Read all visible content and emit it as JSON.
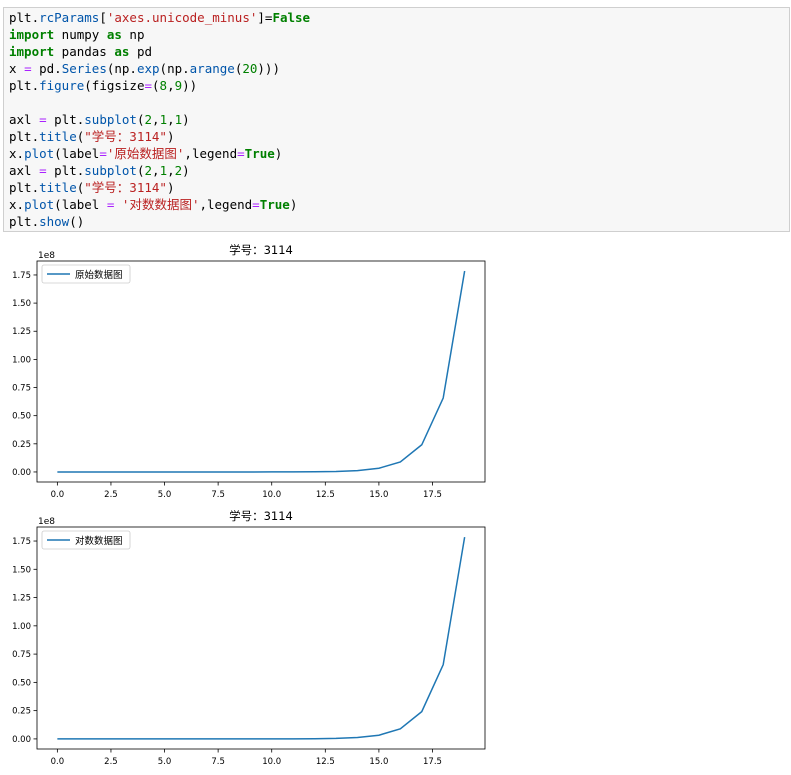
{
  "code_cell": {
    "lines": [
      [
        {
          "t": "plt.",
          "c": "plain"
        },
        {
          "t": "rcParams",
          "c": "fn"
        },
        {
          "t": "[",
          "c": "plain"
        },
        {
          "t": "'axes.unicode_minus'",
          "c": "str"
        },
        {
          "t": "]=",
          "c": "plain"
        },
        {
          "t": "False",
          "c": "bool"
        }
      ],
      [
        {
          "t": "import",
          "c": "kw"
        },
        {
          "t": " numpy ",
          "c": "plain"
        },
        {
          "t": "as",
          "c": "kw"
        },
        {
          "t": " np",
          "c": "plain"
        }
      ],
      [
        {
          "t": "import",
          "c": "kw"
        },
        {
          "t": " pandas ",
          "c": "plain"
        },
        {
          "t": "as",
          "c": "kw"
        },
        {
          "t": " pd",
          "c": "plain"
        }
      ],
      [
        {
          "t": "x ",
          "c": "plain"
        },
        {
          "t": "=",
          "c": "op"
        },
        {
          "t": " pd.",
          "c": "plain"
        },
        {
          "t": "Series",
          "c": "fn"
        },
        {
          "t": "(np.",
          "c": "plain"
        },
        {
          "t": "exp",
          "c": "fn"
        },
        {
          "t": "(np.",
          "c": "plain"
        },
        {
          "t": "arange",
          "c": "fn"
        },
        {
          "t": "(",
          "c": "plain"
        },
        {
          "t": "20",
          "c": "num"
        },
        {
          "t": ")))",
          "c": "plain"
        }
      ],
      [
        {
          "t": "plt.",
          "c": "plain"
        },
        {
          "t": "figure",
          "c": "fn"
        },
        {
          "t": "(figsize",
          "c": "plain"
        },
        {
          "t": "=",
          "c": "op"
        },
        {
          "t": "(",
          "c": "plain"
        },
        {
          "t": "8",
          "c": "num"
        },
        {
          "t": ",",
          "c": "plain"
        },
        {
          "t": "9",
          "c": "num"
        },
        {
          "t": "))",
          "c": "plain"
        }
      ],
      [],
      [
        {
          "t": "axl ",
          "c": "plain"
        },
        {
          "t": "=",
          "c": "op"
        },
        {
          "t": " plt.",
          "c": "plain"
        },
        {
          "t": "subplot",
          "c": "fn"
        },
        {
          "t": "(",
          "c": "plain"
        },
        {
          "t": "2",
          "c": "num"
        },
        {
          "t": ",",
          "c": "plain"
        },
        {
          "t": "1",
          "c": "num"
        },
        {
          "t": ",",
          "c": "plain"
        },
        {
          "t": "1",
          "c": "num"
        },
        {
          "t": ")",
          "c": "plain"
        }
      ],
      [
        {
          "t": "plt.",
          "c": "plain"
        },
        {
          "t": "title",
          "c": "fn"
        },
        {
          "t": "(",
          "c": "plain"
        },
        {
          "t": "\"学号：3114\"",
          "c": "str"
        },
        {
          "t": ")",
          "c": "plain"
        }
      ],
      [
        {
          "t": "x.",
          "c": "plain"
        },
        {
          "t": "plot",
          "c": "fn"
        },
        {
          "t": "(label",
          "c": "plain"
        },
        {
          "t": "=",
          "c": "op"
        },
        {
          "t": "'原始数据图'",
          "c": "str"
        },
        {
          "t": ",legend",
          "c": "plain"
        },
        {
          "t": "=",
          "c": "op"
        },
        {
          "t": "True",
          "c": "bool"
        },
        {
          "t": ")",
          "c": "plain"
        }
      ],
      [
        {
          "t": "axl ",
          "c": "plain"
        },
        {
          "t": "=",
          "c": "op"
        },
        {
          "t": " plt.",
          "c": "plain"
        },
        {
          "t": "subplot",
          "c": "fn"
        },
        {
          "t": "(",
          "c": "plain"
        },
        {
          "t": "2",
          "c": "num"
        },
        {
          "t": ",",
          "c": "plain"
        },
        {
          "t": "1",
          "c": "num"
        },
        {
          "t": ",",
          "c": "plain"
        },
        {
          "t": "2",
          "c": "num"
        },
        {
          "t": ")",
          "c": "plain"
        }
      ],
      [
        {
          "t": "plt.",
          "c": "plain"
        },
        {
          "t": "title",
          "c": "fn"
        },
        {
          "t": "(",
          "c": "plain"
        },
        {
          "t": "\"学号：3114\"",
          "c": "str"
        },
        {
          "t": ")",
          "c": "plain"
        }
      ],
      [
        {
          "t": "x.",
          "c": "plain"
        },
        {
          "t": "plot",
          "c": "fn"
        },
        {
          "t": "(label ",
          "c": "plain"
        },
        {
          "t": "=",
          "c": "op"
        },
        {
          "t": " ",
          "c": "plain"
        },
        {
          "t": "'对数数据图'",
          "c": "str"
        },
        {
          "t": ",legend",
          "c": "plain"
        },
        {
          "t": "=",
          "c": "op"
        },
        {
          "t": "True",
          "c": "bool"
        },
        {
          "t": ")",
          "c": "plain"
        }
      ],
      [
        {
          "t": "plt.",
          "c": "plain"
        },
        {
          "t": "show",
          "c": "fn"
        },
        {
          "t": "()",
          "c": "plain"
        }
      ]
    ]
  },
  "colors": {
    "line": "#1f77b4",
    "axes_edge": "#000000",
    "legend_edge": "#cccccc",
    "cell_bg": "#f7f7f7"
  },
  "chart_data": [
    {
      "type": "line",
      "title": "学号：3114",
      "offset_text": "1e8",
      "x": [
        0,
        1,
        2,
        3,
        4,
        5,
        6,
        7,
        8,
        9,
        10,
        11,
        12,
        13,
        14,
        15,
        16,
        17,
        18,
        19
      ],
      "series": [
        {
          "name": "原始数据图",
          "values": [
            1.0,
            2.718,
            7.389,
            20.09,
            54.6,
            148.4,
            403.4,
            1096.6,
            2981.0,
            8103.1,
            22026.5,
            59874.1,
            162754.8,
            442413.4,
            1202604.3,
            3269017.4,
            8886110.5,
            24154952.8,
            65659969.1,
            178482301.0
          ]
        }
      ],
      "xticks": [
        "0.0",
        "2.5",
        "5.0",
        "7.5",
        "10.0",
        "12.5",
        "15.0",
        "17.5"
      ],
      "xtick_values": [
        0,
        2.5,
        5,
        7.5,
        10,
        12.5,
        15,
        17.5
      ],
      "yticks": [
        "0.00",
        "0.25",
        "0.50",
        "0.75",
        "1.00",
        "1.25",
        "1.50",
        "1.75"
      ],
      "ytick_values": [
        0,
        0.25,
        0.5,
        0.75,
        1.0,
        1.25,
        1.5,
        1.75
      ],
      "y_scale_factor": 100000000,
      "xlim": [
        -0.95,
        19.95
      ],
      "ylim": [
        -8924114,
        187406415
      ],
      "legend_position": "upper left",
      "grid": false
    },
    {
      "type": "line",
      "title": "学号：3114",
      "offset_text": "1e8",
      "x": [
        0,
        1,
        2,
        3,
        4,
        5,
        6,
        7,
        8,
        9,
        10,
        11,
        12,
        13,
        14,
        15,
        16,
        17,
        18,
        19
      ],
      "series": [
        {
          "name": "对数数据图",
          "values": [
            1.0,
            2.718,
            7.389,
            20.09,
            54.6,
            148.4,
            403.4,
            1096.6,
            2981.0,
            8103.1,
            22026.5,
            59874.1,
            162754.8,
            442413.4,
            1202604.3,
            3269017.4,
            8886110.5,
            24154952.8,
            65659969.1,
            178482301.0
          ]
        }
      ],
      "xticks": [
        "0.0",
        "2.5",
        "5.0",
        "7.5",
        "10.0",
        "12.5",
        "15.0",
        "17.5"
      ],
      "xtick_values": [
        0,
        2.5,
        5,
        7.5,
        10,
        12.5,
        15,
        17.5
      ],
      "yticks": [
        "0.00",
        "0.25",
        "0.50",
        "0.75",
        "1.00",
        "1.25",
        "1.50",
        "1.75"
      ],
      "ytick_values": [
        0,
        0.25,
        0.5,
        0.75,
        1.0,
        1.25,
        1.5,
        1.75
      ],
      "y_scale_factor": 100000000,
      "xlim": [
        -0.95,
        19.95
      ],
      "ylim": [
        -8924114,
        187406415
      ],
      "legend_position": "upper left",
      "grid": false
    }
  ]
}
